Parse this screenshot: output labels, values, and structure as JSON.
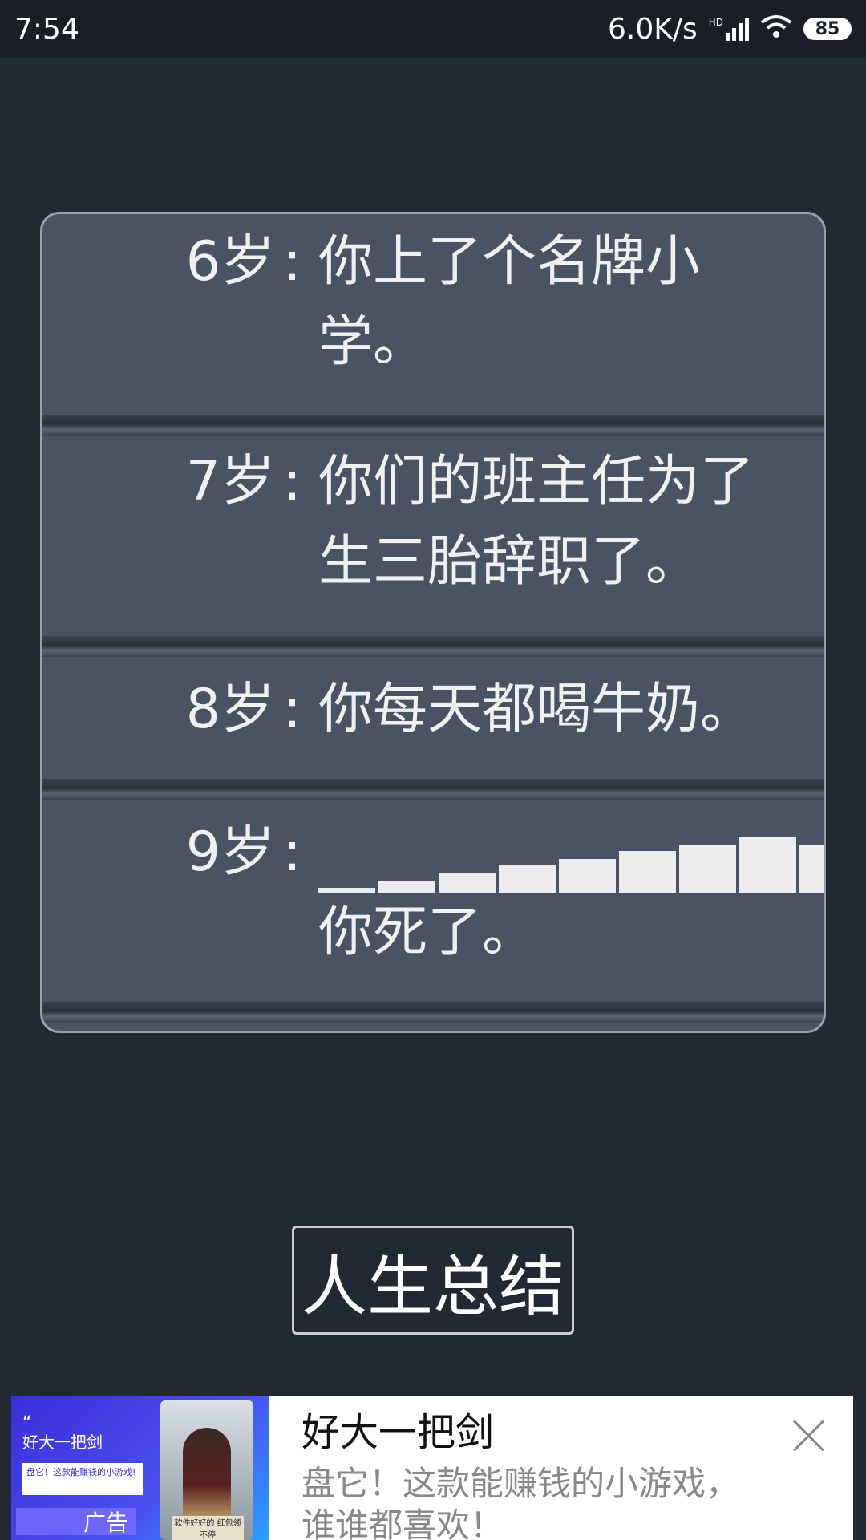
{
  "status_bar": {
    "time": "7:54",
    "net_speed": "6.0K/s",
    "signal_label": "HD",
    "battery": "85"
  },
  "timeline": [
    {
      "age": "6岁",
      "colon": ":",
      "text": "你上了个名牌小学。"
    },
    {
      "age": "7岁",
      "colon": ":",
      "text": "你们的班主任为了生三胎辞职了。"
    },
    {
      "age": "8岁",
      "colon": ":",
      "text": "你每天都喝牛奶。"
    },
    {
      "age": "9岁",
      "colon": ":",
      "text": "你死了。"
    }
  ],
  "summary_button": "人生总结",
  "ad": {
    "title": "好大一把剑",
    "description": "盘它！这款能赚钱的小游戏，谁谁都喜欢！",
    "image_title": "好大一把剑",
    "image_subtitle": "盘它！这款能赚钱的小游戏!",
    "image_badge": "广告",
    "image_caption": "软件好好的 红包领不停"
  },
  "colors": {
    "background": "#232933",
    "panel": "#4a5363",
    "text": "#f0f0f0"
  }
}
